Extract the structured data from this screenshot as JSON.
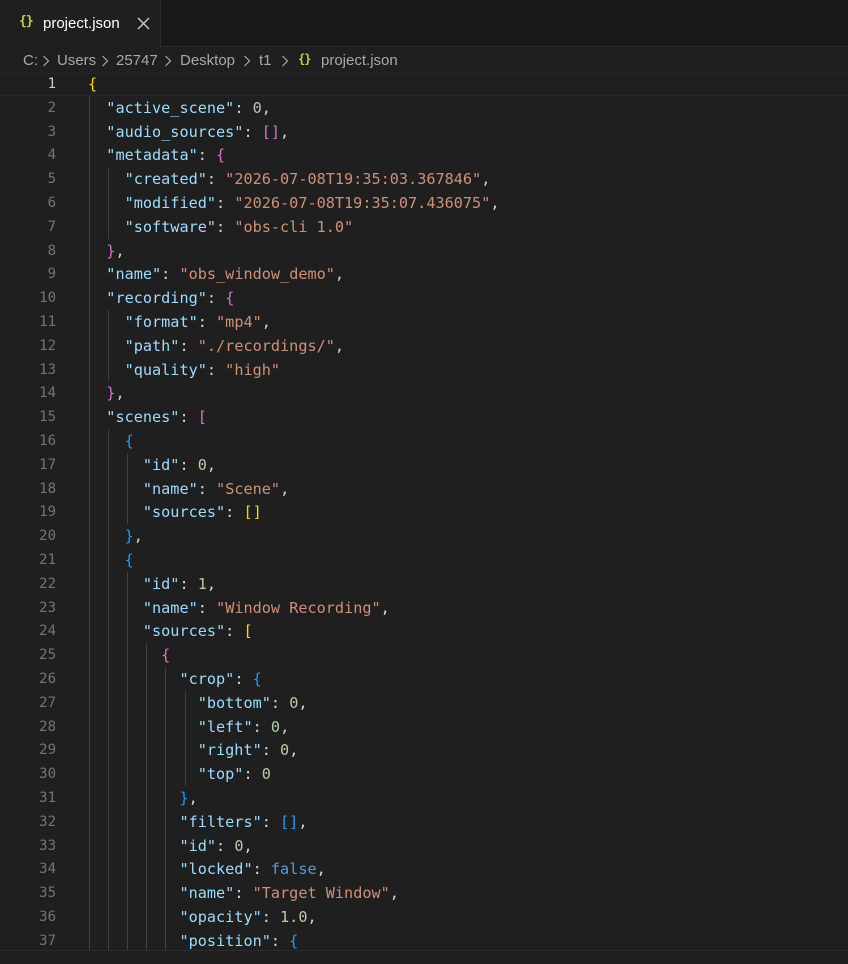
{
  "tab": {
    "icon_text": "{}",
    "label": "project.json",
    "close_icon": "close-icon"
  },
  "breadcrumb": {
    "items": [
      "C:",
      "Users",
      "25747",
      "Desktop",
      "t1"
    ],
    "file_icon_text": "{}",
    "file": "project.json"
  },
  "colors": {
    "background": "#1f1f1f",
    "key": "#9cdcfe",
    "string": "#ce9178",
    "number": "#b5cea8",
    "boolean": "#569cd6",
    "bracket_level_1": "#ffd700",
    "bracket_level_2": "#da70d6",
    "bracket_level_3": "#179fff"
  },
  "editor": {
    "active_line": 1,
    "lines": [
      [
        [
          "{",
          "b1"
        ]
      ],
      [
        [
          "  ",
          ""
        ],
        [
          "\"active_scene\"",
          "k"
        ],
        [
          ": ",
          "p"
        ],
        [
          "0",
          "n"
        ],
        [
          ",",
          "p"
        ]
      ],
      [
        [
          "  ",
          ""
        ],
        [
          "\"audio_sources\"",
          "k"
        ],
        [
          ": ",
          "p"
        ],
        [
          "[]",
          "b2"
        ],
        [
          ",",
          "p"
        ]
      ],
      [
        [
          "  ",
          ""
        ],
        [
          "\"metadata\"",
          "k"
        ],
        [
          ": ",
          "p"
        ],
        [
          "{",
          "b2"
        ]
      ],
      [
        [
          "    ",
          ""
        ],
        [
          "\"created\"",
          "k"
        ],
        [
          ": ",
          "p"
        ],
        [
          "\"2026-07-08T19:35:03.367846\"",
          "s"
        ],
        [
          ",",
          "p"
        ]
      ],
      [
        [
          "    ",
          ""
        ],
        [
          "\"modified\"",
          "k"
        ],
        [
          ": ",
          "p"
        ],
        [
          "\"2026-07-08T19:35:07.436075\"",
          "s"
        ],
        [
          ",",
          "p"
        ]
      ],
      [
        [
          "    ",
          ""
        ],
        [
          "\"software\"",
          "k"
        ],
        [
          ": ",
          "p"
        ],
        [
          "\"obs-cli 1.0\"",
          "s"
        ]
      ],
      [
        [
          "  ",
          ""
        ],
        [
          "}",
          "b2"
        ],
        [
          ",",
          "p"
        ]
      ],
      [
        [
          "  ",
          ""
        ],
        [
          "\"name\"",
          "k"
        ],
        [
          ": ",
          "p"
        ],
        [
          "\"obs_window_demo\"",
          "s"
        ],
        [
          ",",
          "p"
        ]
      ],
      [
        [
          "  ",
          ""
        ],
        [
          "\"recording\"",
          "k"
        ],
        [
          ": ",
          "p"
        ],
        [
          "{",
          "b2"
        ]
      ],
      [
        [
          "    ",
          ""
        ],
        [
          "\"format\"",
          "k"
        ],
        [
          ": ",
          "p"
        ],
        [
          "\"mp4\"",
          "s"
        ],
        [
          ",",
          "p"
        ]
      ],
      [
        [
          "    ",
          ""
        ],
        [
          "\"path\"",
          "k"
        ],
        [
          ": ",
          "p"
        ],
        [
          "\"./recordings/\"",
          "s"
        ],
        [
          ",",
          "p"
        ]
      ],
      [
        [
          "    ",
          ""
        ],
        [
          "\"quality\"",
          "k"
        ],
        [
          ": ",
          "p"
        ],
        [
          "\"high\"",
          "s"
        ]
      ],
      [
        [
          "  ",
          ""
        ],
        [
          "}",
          "b2"
        ],
        [
          ",",
          "p"
        ]
      ],
      [
        [
          "  ",
          ""
        ],
        [
          "\"scenes\"",
          "k"
        ],
        [
          ": ",
          "p"
        ],
        [
          "[",
          "b2"
        ]
      ],
      [
        [
          "    ",
          ""
        ],
        [
          "{",
          "b3"
        ]
      ],
      [
        [
          "      ",
          ""
        ],
        [
          "\"id\"",
          "k"
        ],
        [
          ": ",
          "p"
        ],
        [
          "0",
          "n"
        ],
        [
          ",",
          "p"
        ]
      ],
      [
        [
          "      ",
          ""
        ],
        [
          "\"name\"",
          "k"
        ],
        [
          ": ",
          "p"
        ],
        [
          "\"Scene\"",
          "s"
        ],
        [
          ",",
          "p"
        ]
      ],
      [
        [
          "      ",
          ""
        ],
        [
          "\"sources\"",
          "k"
        ],
        [
          ": ",
          "p"
        ],
        [
          "[]",
          "b1"
        ]
      ],
      [
        [
          "    ",
          ""
        ],
        [
          "}",
          "b3"
        ],
        [
          ",",
          "p"
        ]
      ],
      [
        [
          "    ",
          ""
        ],
        [
          "{",
          "b3"
        ]
      ],
      [
        [
          "      ",
          ""
        ],
        [
          "\"id\"",
          "k"
        ],
        [
          ": ",
          "p"
        ],
        [
          "1",
          "n"
        ],
        [
          ",",
          "p"
        ]
      ],
      [
        [
          "      ",
          ""
        ],
        [
          "\"name\"",
          "k"
        ],
        [
          ": ",
          "p"
        ],
        [
          "\"Window Recording\"",
          "s"
        ],
        [
          ",",
          "p"
        ]
      ],
      [
        [
          "      ",
          ""
        ],
        [
          "\"sources\"",
          "k"
        ],
        [
          ": ",
          "p"
        ],
        [
          "[",
          "b1"
        ]
      ],
      [
        [
          "        ",
          ""
        ],
        [
          "{",
          "b2"
        ]
      ],
      [
        [
          "          ",
          ""
        ],
        [
          "\"crop\"",
          "k"
        ],
        [
          ": ",
          "p"
        ],
        [
          "{",
          "b3"
        ]
      ],
      [
        [
          "            ",
          ""
        ],
        [
          "\"bottom\"",
          "k"
        ],
        [
          ": ",
          "p"
        ],
        [
          "0",
          "n"
        ],
        [
          ",",
          "p"
        ]
      ],
      [
        [
          "            ",
          ""
        ],
        [
          "\"left\"",
          "k"
        ],
        [
          ": ",
          "p"
        ],
        [
          "0",
          "n"
        ],
        [
          ",",
          "p"
        ]
      ],
      [
        [
          "            ",
          ""
        ],
        [
          "\"right\"",
          "k"
        ],
        [
          ": ",
          "p"
        ],
        [
          "0",
          "n"
        ],
        [
          ",",
          "p"
        ]
      ],
      [
        [
          "            ",
          ""
        ],
        [
          "\"top\"",
          "k"
        ],
        [
          ": ",
          "p"
        ],
        [
          "0",
          "n"
        ]
      ],
      [
        [
          "          ",
          ""
        ],
        [
          "}",
          "b3"
        ],
        [
          ",",
          "p"
        ]
      ],
      [
        [
          "          ",
          ""
        ],
        [
          "\"filters\"",
          "k"
        ],
        [
          ": ",
          "p"
        ],
        [
          "[]",
          "b3"
        ],
        [
          ",",
          "p"
        ]
      ],
      [
        [
          "          ",
          ""
        ],
        [
          "\"id\"",
          "k"
        ],
        [
          ": ",
          "p"
        ],
        [
          "0",
          "n"
        ],
        [
          ",",
          "p"
        ]
      ],
      [
        [
          "          ",
          ""
        ],
        [
          "\"locked\"",
          "k"
        ],
        [
          ": ",
          "p"
        ],
        [
          "false",
          "b"
        ],
        [
          ",",
          "p"
        ]
      ],
      [
        [
          "          ",
          ""
        ],
        [
          "\"name\"",
          "k"
        ],
        [
          ": ",
          "p"
        ],
        [
          "\"Target Window\"",
          "s"
        ],
        [
          ",",
          "p"
        ]
      ],
      [
        [
          "          ",
          ""
        ],
        [
          "\"opacity\"",
          "k"
        ],
        [
          ": ",
          "p"
        ],
        [
          "1.0",
          "n"
        ],
        [
          ",",
          "p"
        ]
      ],
      [
        [
          "          ",
          ""
        ],
        [
          "\"position\"",
          "k"
        ],
        [
          ": ",
          "p"
        ],
        [
          "{",
          "b3"
        ]
      ]
    ]
  }
}
